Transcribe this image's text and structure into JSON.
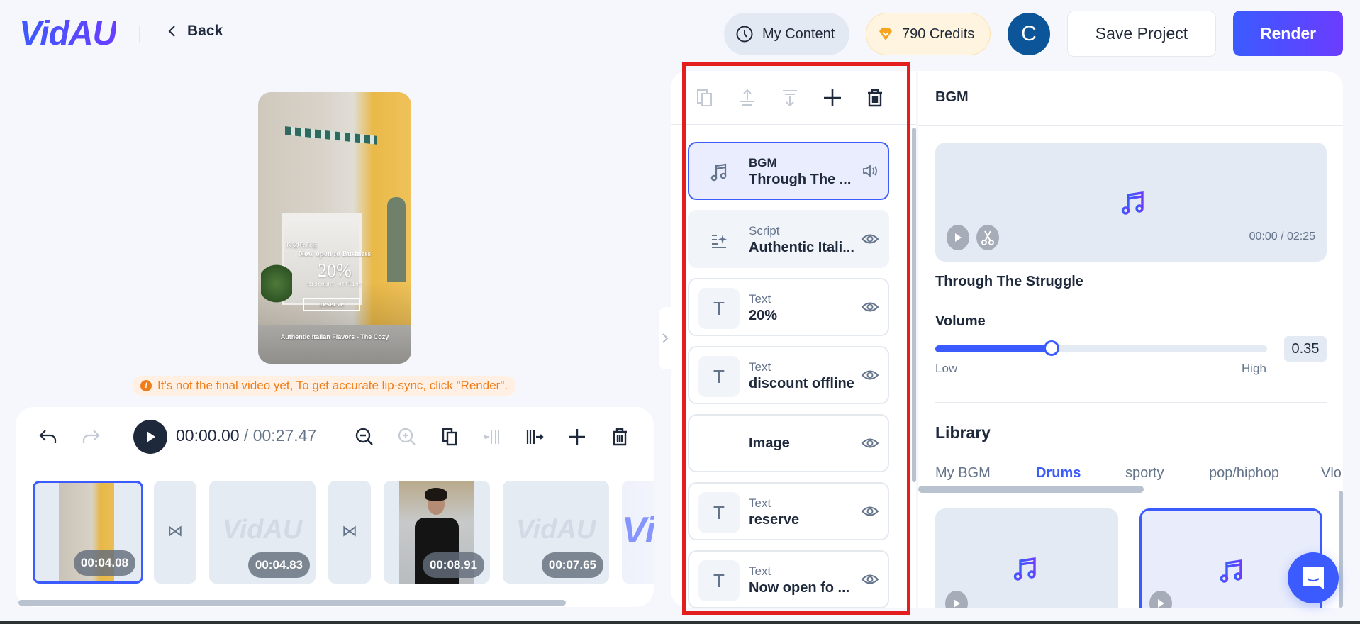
{
  "header": {
    "logo": "VidAU",
    "back_label": "Back",
    "my_content_label": "My Content",
    "credits_label": "790 Credits",
    "avatar_initial": "C",
    "save_label": "Save Project",
    "render_label": "Render"
  },
  "preview": {
    "brand": "NØRRE",
    "headline": "Now open fo Business",
    "percent": "20%",
    "discount": "discount offline",
    "reserve": "reserve",
    "caption": "Authentic Italian Flavors - The Cozy",
    "notice": "It's not the final video yet, To get accurate lip-sync, click \"Render\"."
  },
  "timeline": {
    "current_time": "00:00.00",
    "separator": " / ",
    "total_time": "00:27.47",
    "clips": [
      {
        "duration": "00:04.08",
        "selected": true
      },
      {
        "type": "transition"
      },
      {
        "duration": "00:04.83",
        "watermark": "VidAU"
      },
      {
        "type": "transition"
      },
      {
        "duration": "00:08.91"
      },
      {
        "duration": "00:07.65",
        "watermark": "VidAU"
      },
      {
        "watermark": "Vi"
      }
    ]
  },
  "layers": {
    "items": [
      {
        "type": "BGM",
        "name": "Through The ...",
        "icon": "music-note-icon",
        "action": "volume-icon",
        "selected": true
      },
      {
        "type": "Script",
        "name": "Authentic Itali...",
        "icon": "script-sparkle-icon",
        "action": "eye-icon"
      },
      {
        "type": "Text",
        "name": "20%",
        "icon": "T",
        "action": "eye-icon"
      },
      {
        "type": "Text",
        "name": "discount offline",
        "icon": "T",
        "action": "eye-icon"
      },
      {
        "type": "",
        "name": "Image",
        "icon": "",
        "action": "eye-icon"
      },
      {
        "type": "Text",
        "name": "reserve",
        "icon": "T",
        "action": "eye-icon"
      },
      {
        "type": "Text",
        "name": "Now open fo ...",
        "icon": "T",
        "action": "eye-icon"
      }
    ]
  },
  "props": {
    "title": "BGM",
    "player_time": "00:00 / 02:25",
    "track_name": "Through The Struggle",
    "volume_label": "Volume",
    "volume_value": "0.35",
    "volume_fraction": 0.35,
    "low_label": "Low",
    "high_label": "High",
    "library_title": "Library",
    "library_tabs": [
      "My BGM",
      "Drums",
      "sporty",
      "pop/hiphop",
      "Vlo"
    ],
    "active_tab": "Drums"
  },
  "colors": {
    "accent": "#3b5bff",
    "render_gradient_end": "#6b3cff",
    "notice": "#f07d1a",
    "highlight_box": "#e41e1e"
  }
}
